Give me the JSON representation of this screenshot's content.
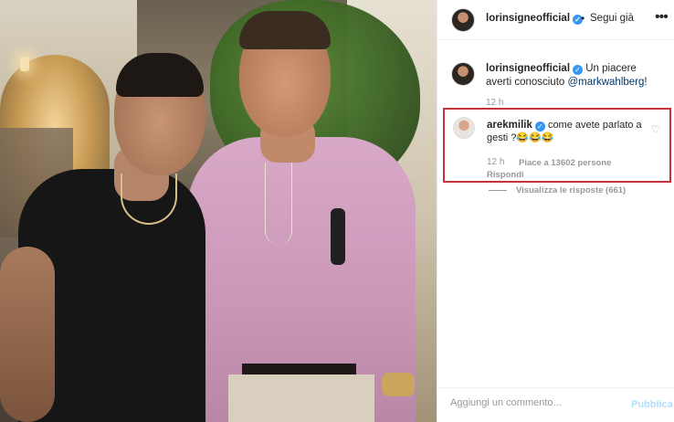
{
  "post": {
    "image_alt": ""
  },
  "header": {
    "username": "lorinsigneofficial",
    "separator": "•",
    "follow_label": "Segui già",
    "more_icon": "more-icon"
  },
  "caption": {
    "username": "lorinsigneofficial",
    "text": "Un piacere averti conosciuto",
    "mention": "@markwahlberg",
    "suffix": "!",
    "time": "12 h"
  },
  "highlighted_comment": {
    "username": "arekmilik",
    "text": "come avete parlato a gesti ?😂😂😂",
    "time": "12 h",
    "likes": "Piace a 13602 persone",
    "reply_label": "Rispondi",
    "border_color": "#c8323c"
  },
  "replies": {
    "label": "Visualizza le risposte (661)"
  },
  "composer": {
    "placeholder": "Aggiungi un commento...",
    "publish_label": "Pubblica"
  },
  "colors": {
    "verified": "#3897f0",
    "mention": "#003569",
    "publish_disabled": "#b2dffc"
  }
}
